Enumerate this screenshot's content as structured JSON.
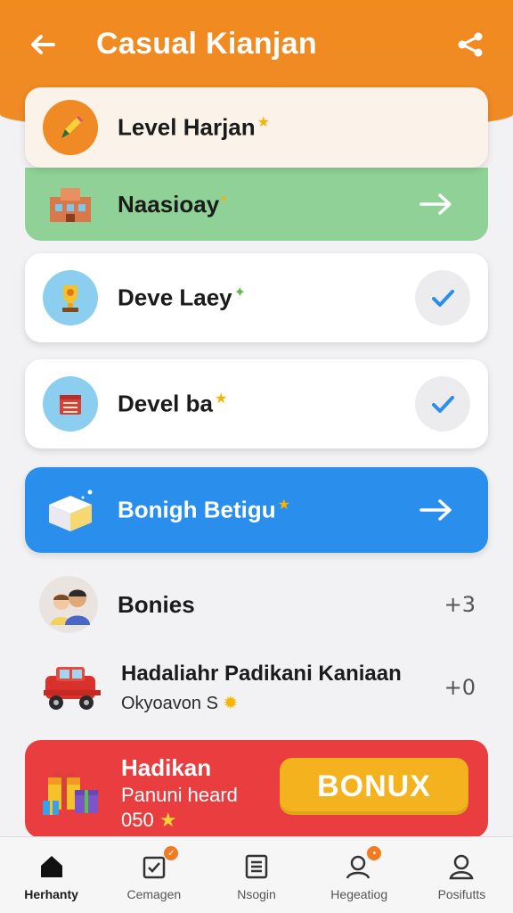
{
  "header": {
    "title": "Casual Kianjan",
    "back_icon": "back-arrow-icon",
    "share_icon": "share-icon"
  },
  "cards": [
    {
      "label": "Level Harjan",
      "icon": "pencil-icon",
      "action": "none"
    },
    {
      "label": "Naasioay",
      "icon": "building-icon",
      "action": "arrow"
    },
    {
      "label": "Deve Laey",
      "icon": "trophy-icon",
      "action": "check"
    },
    {
      "label": "Devel ba",
      "icon": "chest-icon",
      "action": "check"
    },
    {
      "label": "Bonigh Betigu",
      "icon": "box-icon",
      "action": "arrow"
    }
  ],
  "rows": [
    {
      "label": "Bonies",
      "count": "+3",
      "icon": "friends-avatar"
    },
    {
      "title": "Hadaliahr Padikani Kaniaan",
      "subtitle": "Okyoavon S",
      "count": "+0",
      "icon": "truck-icon"
    }
  ],
  "bonus": {
    "title": "Hadikan",
    "subtitle_1": "Panuni heard",
    "subtitle_2": "050",
    "button_label": "BONUX",
    "icon": "gift-icon"
  },
  "tabs": [
    {
      "label": "Herhanty",
      "icon": "home-icon",
      "active": true
    },
    {
      "label": "Cemagen",
      "icon": "calendar-icon",
      "badge": ""
    },
    {
      "label": "Nsogin",
      "icon": "list-icon"
    },
    {
      "label": "Hegeatiog",
      "icon": "profile-icon",
      "badge": ""
    },
    {
      "label": "Posifutts",
      "icon": "user-icon"
    }
  ],
  "colors": {
    "header": "#f18a1f",
    "green_card": "#8fd196",
    "blue_card": "#2a8fec",
    "bonus_card": "#ea3d3f",
    "bonus_button": "#f4b21e",
    "check": "#2a8fec"
  }
}
